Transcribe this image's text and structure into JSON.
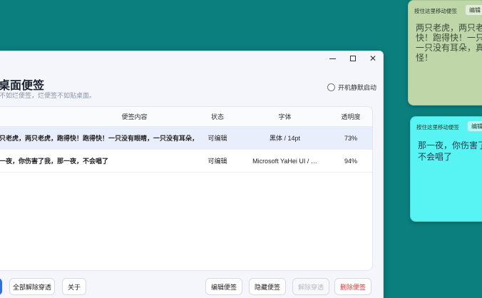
{
  "window": {
    "title": "的桌面便签",
    "subtitle": "不如烂便签，烂便签不如贴桌面。",
    "controls": {
      "minimize": "—",
      "maximize": "☐",
      "close": "✕"
    },
    "autostart_label": "开机静默启动"
  },
  "table": {
    "headers": {
      "content": "便签内容",
      "status": "状态",
      "font": "字体",
      "opacity": "透明度"
    },
    "rows": [
      {
        "content": "只老虎，两只老虎，跑得快！跑得快！一只没有眼睛，一只没有耳朵，…",
        "status": "可编辑",
        "font": "黑体 / 14pt",
        "opacity": "73%"
      },
      {
        "content": "一夜，你伤害了我，那一夜，不会唱了",
        "status": "可编辑",
        "font": "Microsoft YaHei UI / …",
        "opacity": "94%"
      }
    ]
  },
  "footer": {
    "unpin_all": "全部解除穿透",
    "about": "关于",
    "edit": "编辑便签",
    "hide": "隐藏便签",
    "unpin": "解除穿透",
    "delete": "删除便签"
  },
  "notes": [
    {
      "drag_label": "按住这里移动便签",
      "edit_label": "编辑",
      "lines": [
        "两只老虎，两只老",
        "快！跑得快！一只",
        "一只没有耳朵，真",
        "怪！"
      ],
      "color": "#bfd7a8"
    },
    {
      "drag_label": "按住这里移动便签",
      "edit_label": "编辑",
      "lines": [
        "那一夜，你伤害了",
        "不会唱了"
      ],
      "color": "#57f4f3"
    }
  ],
  "colors": {
    "desktop": "#0b7f7e",
    "primary": "#2f6fe0",
    "danger": "#d23b3b"
  }
}
